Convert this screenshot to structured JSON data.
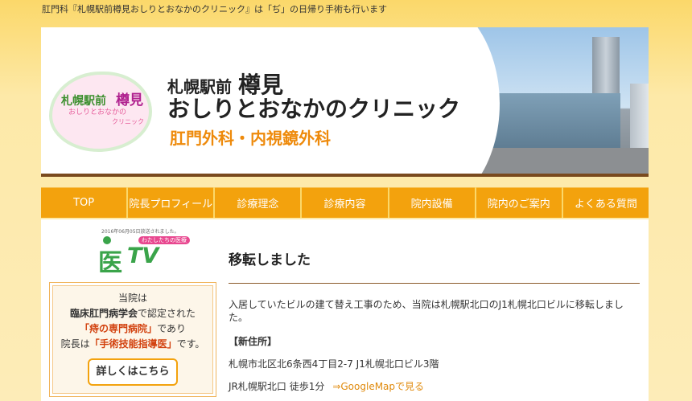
{
  "top_bar": {
    "text": "肛門科『札幌駅前樽見おしりとおなかのクリニック』は「ぢ」の日帰り手術も行います"
  },
  "banner": {
    "logo": {
      "line1": "札幌駅前",
      "tarumi": "樽見",
      "line2": "おしりとおなかの",
      "line3": "クリニック"
    },
    "title_prefix": "札幌駅前",
    "title_tarumi": "樽見",
    "title_main": "おしりとおなかのクリニック",
    "departments": "肛門外科・内視鏡外科"
  },
  "nav": {
    "items": [
      {
        "label": "TOP"
      },
      {
        "label": "院長プロフィール"
      },
      {
        "label": "診療理念"
      },
      {
        "label": "診療内容"
      },
      {
        "label": "院内設備"
      },
      {
        "label": "院内のご案内"
      },
      {
        "label": "よくある質問"
      }
    ]
  },
  "sidebar": {
    "tv_caption": "2016年06月05日放送されました。",
    "tv_logo": {
      "kanji": "医",
      "letters": "TV",
      "tag": "わたしたちの医療"
    },
    "info": {
      "line1": "当院は",
      "line2_bold": "臨床肛門病学会",
      "line2_rest": "で認定された",
      "line3_red": "「痔の専門病院」",
      "line3_rest": "であり",
      "line4_prefix": "院長は",
      "line4_red": "「手術技能指導医」",
      "line4_rest": "です。",
      "button": "詳しくはこちら"
    }
  },
  "main": {
    "title": "移転しました",
    "body": "入居していたビルの建て替え工事のため、当院は札幌駅北口のJ1札幌北口ビルに移転しました。",
    "new_address_heading": "【新住所】",
    "address": "札幌市北区北6条西4丁目2-7 J1札幌北口ビル3階",
    "access": "JR札幌駅北口 徒歩1分",
    "map_link": "⇒GoogleMapで見る"
  }
}
